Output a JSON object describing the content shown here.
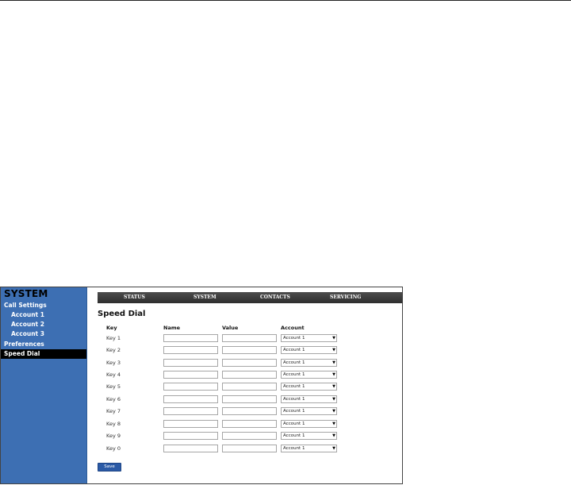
{
  "sidebar": {
    "title": "SYSTEM",
    "items": [
      {
        "label": "Call Settings"
      },
      {
        "label": "Account 1"
      },
      {
        "label": "Account 2"
      },
      {
        "label": "Account 3"
      },
      {
        "label": "Preferences"
      },
      {
        "label": "Speed Dial"
      }
    ],
    "active_item": "Speed Dial",
    "background_color": "#3d6fb3"
  },
  "nav": {
    "items": [
      "STATUS",
      "SYSTEM",
      "CONTACTS",
      "SERVICING"
    ]
  },
  "page": {
    "title": "Speed Dial"
  },
  "table": {
    "headers": [
      "Key",
      "Name",
      "Value",
      "Account"
    ],
    "rows": [
      {
        "key": "Key 1",
        "name": "",
        "value": "",
        "account": "Account 1"
      },
      {
        "key": "Key 2",
        "name": "",
        "value": "",
        "account": "Account 1"
      },
      {
        "key": "Key 3",
        "name": "",
        "value": "",
        "account": "Account 1"
      },
      {
        "key": "Key 4",
        "name": "",
        "value": "",
        "account": "Account 1"
      },
      {
        "key": "Key 5",
        "name": "",
        "value": "",
        "account": "Account 1"
      },
      {
        "key": "Key 6",
        "name": "",
        "value": "",
        "account": "Account 1"
      },
      {
        "key": "Key 7",
        "name": "",
        "value": "",
        "account": "Account 1"
      },
      {
        "key": "Key 8",
        "name": "",
        "value": "",
        "account": "Account 1"
      },
      {
        "key": "Key 9",
        "name": "",
        "value": "",
        "account": "Account 1"
      },
      {
        "key": "Key 0",
        "name": "",
        "value": "",
        "account": "Account 1"
      }
    ]
  },
  "buttons": {
    "save_label": "Save"
  },
  "icons": {
    "dropdown_arrow": "chevron-down-icon"
  },
  "colors": {
    "nav_bar": "#3a3a3a",
    "save_button": "#2b5aa6"
  }
}
